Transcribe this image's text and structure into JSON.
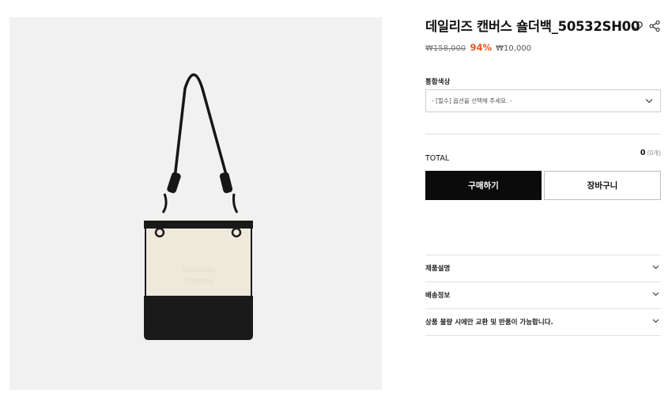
{
  "product": {
    "title": "데일리즈 캔버스 숄더백_50532SH00",
    "price_original": "₩158,000",
    "discount_rate": "94%",
    "price_sale": "₩10,000",
    "image_logo_text": [
      "Samantha",
      "Thavasa"
    ]
  },
  "icons": {
    "wishlist": "heart-outline-icon",
    "share": "share-icon",
    "select_arrow": "chevron-down-icon",
    "accordion_arrow": "chevron-down-icon"
  },
  "option": {
    "label": "통합색상",
    "placeholder": "- [필수] 옵션을 선택해 주세요. -"
  },
  "total": {
    "label": "TOTAL",
    "value": "0",
    "unit": "(0개)"
  },
  "buttons": {
    "buy": "구매하기",
    "cart": "장바구니"
  },
  "accordion": [
    {
      "label": "제품설명"
    },
    {
      "label": "배송정보"
    },
    {
      "label": "상품 불량 시에만 교환 및 반품이 가능합니다."
    }
  ],
  "colors": {
    "buy_button": "#0b0b0b",
    "discount": "#e8541e",
    "image_bg": "#f1f1f1",
    "bag_canvas": "#efe9dc",
    "bag_leather": "#1a1a1a"
  }
}
